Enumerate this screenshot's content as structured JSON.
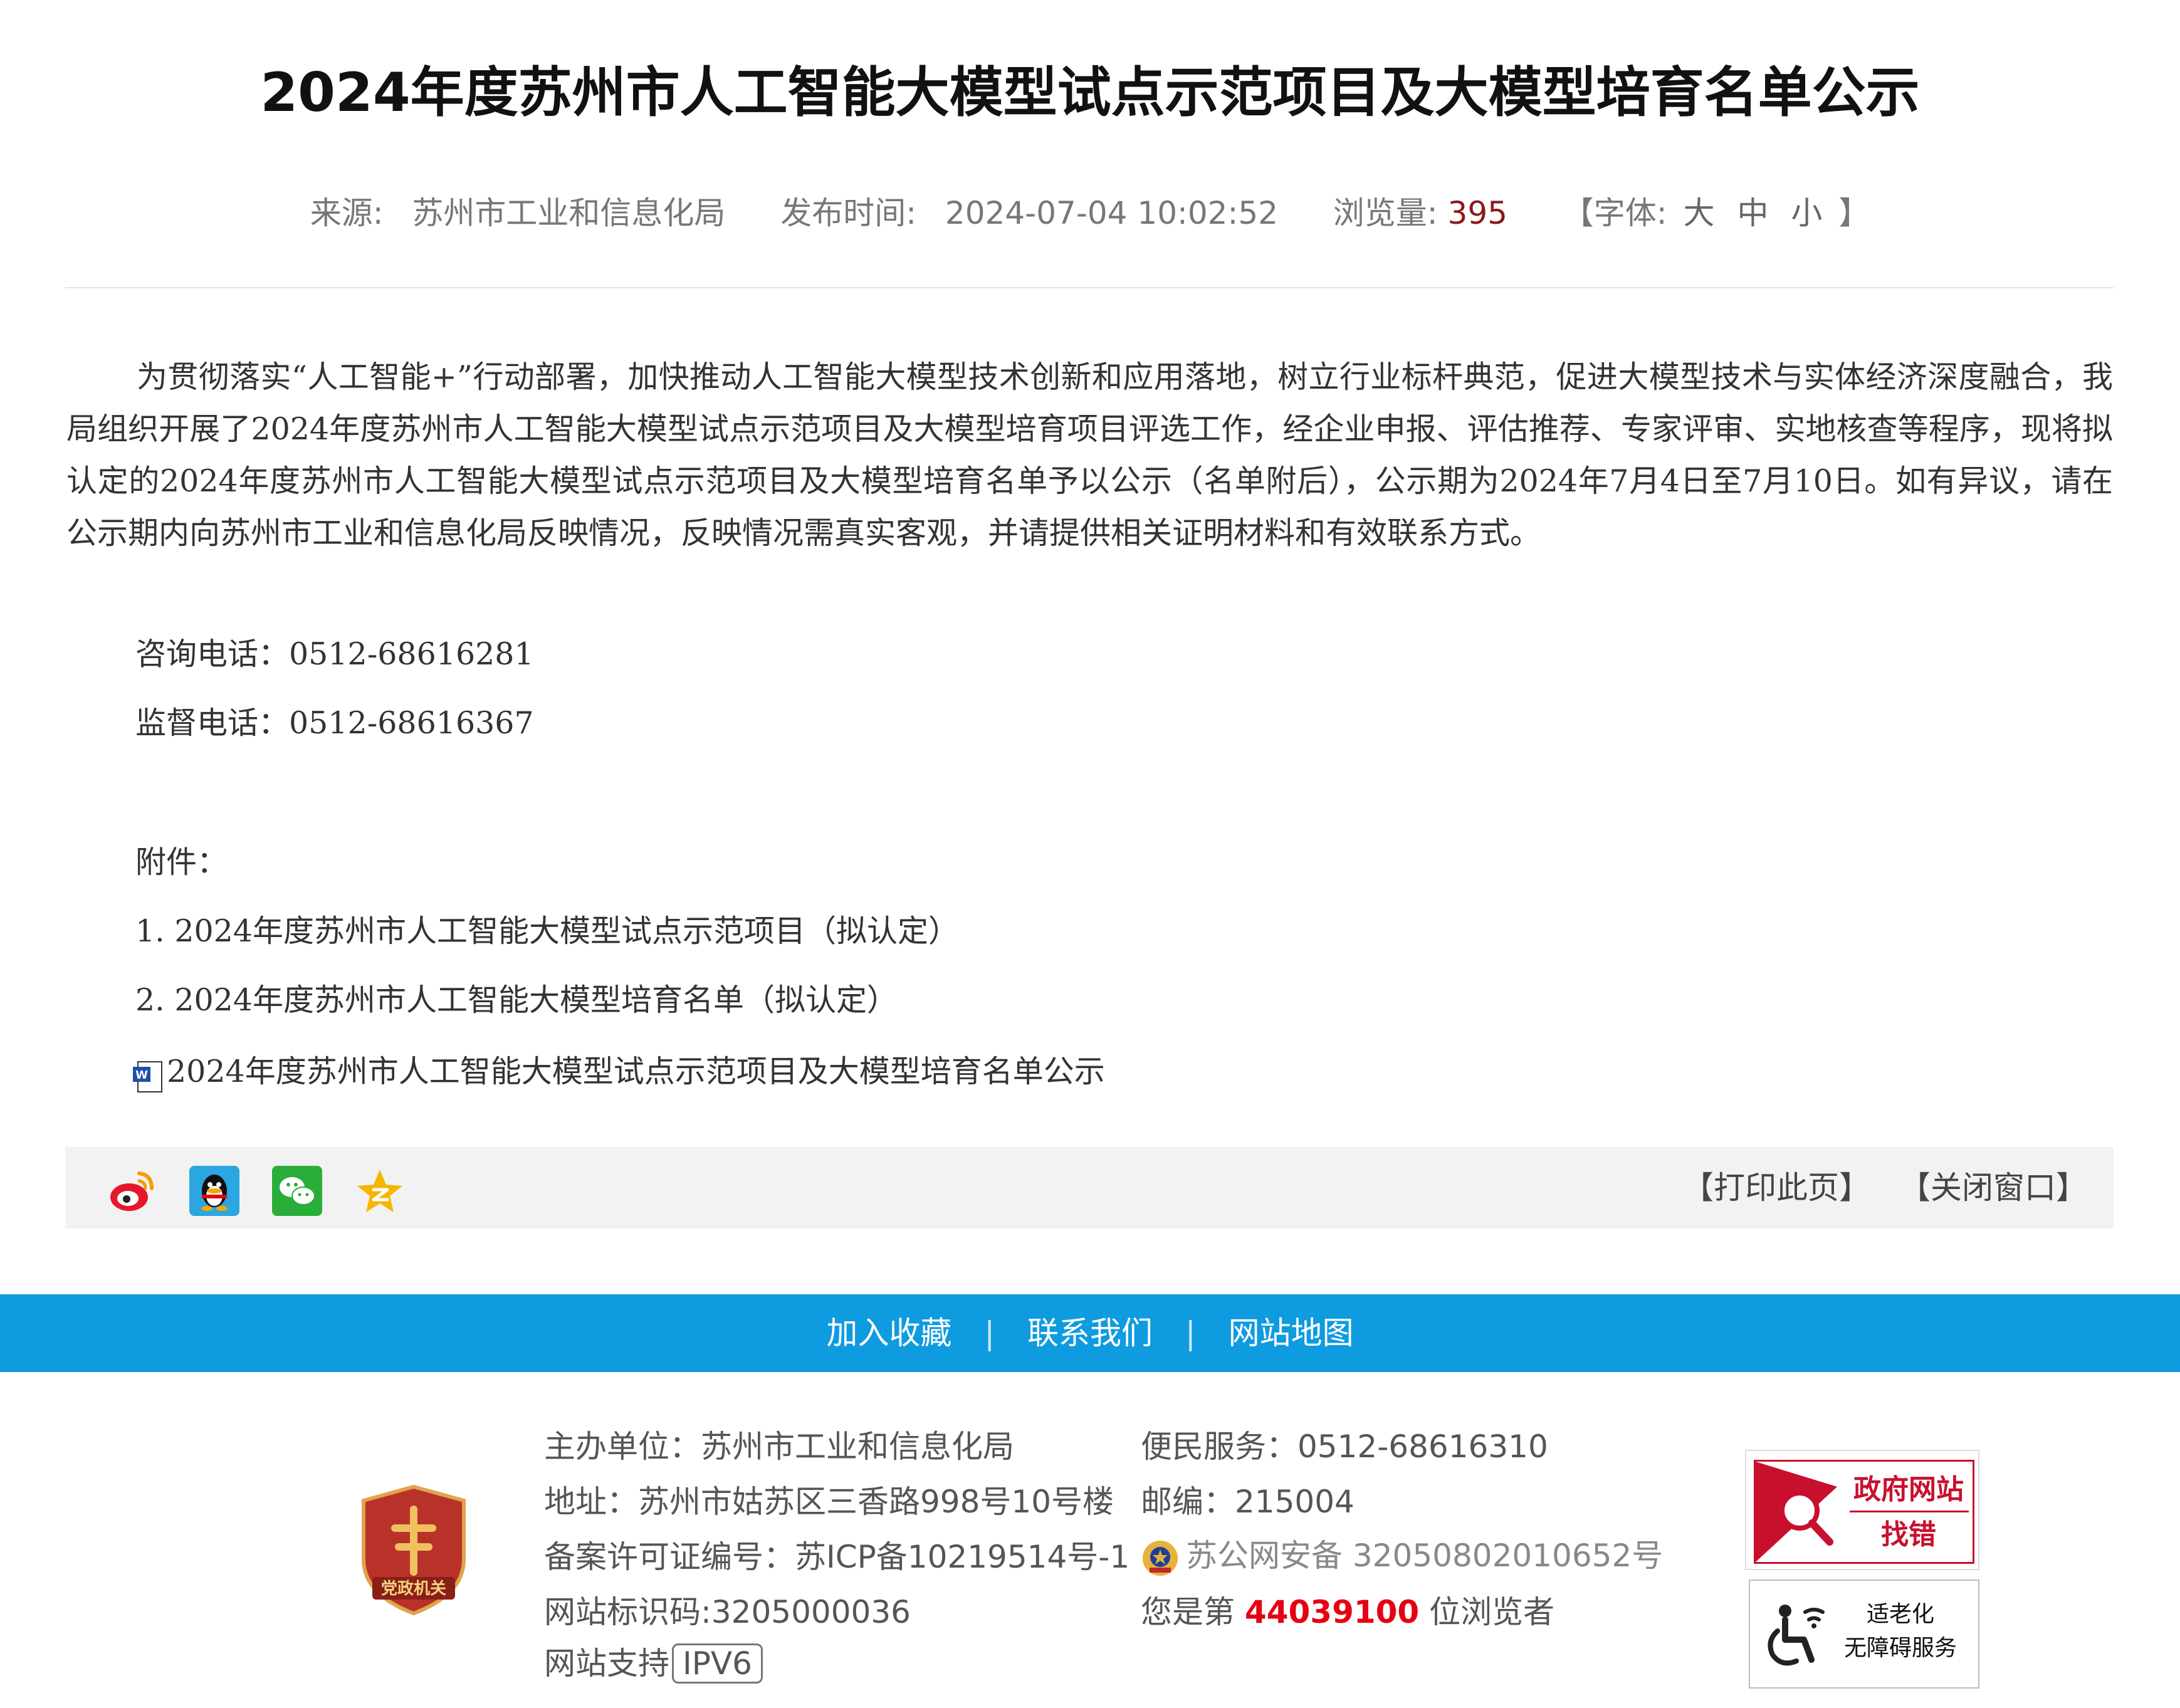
{
  "article": {
    "title": "2024年度苏州市人工智能大模型试点示范项目及大模型培育名单公示",
    "meta": {
      "source_label": "来源:",
      "source": "苏州市工业和信息化局",
      "date_label": "发布时间:",
      "date": "2024-07-04 10:02:52",
      "views_label": "浏览量:",
      "views": "395",
      "font_label_open": "【字体:",
      "font_large": "大",
      "font_medium": "中",
      "font_small": "小",
      "font_label_close": "】"
    },
    "body": "为贯彻落实“人工智能+”行动部署，加快推动人工智能大模型技术创新和应用落地，树立行业标杆典范，促进大模型技术与实体经济深度融合，我局组织开展了2024年度苏州市人工智能大模型试点示范项目及大模型培育项目评选工作，经企业申报、评估推荐、专家评审、实地核查等程序，现将拟认定的2024年度苏州市人工智能大模型试点示范项目及大模型培育名单予以公示（名单附后），公示期为2024年7月4日至7月10日。如有异议，请在公示期内向苏州市工业和信息化局反映情况，反映情况需真实客观，并请提供相关证明材料和有效联系方式。",
    "consult_phone": "咨询电话：0512-68616281",
    "supervise_phone": "监督电话：0512-68616367",
    "attachments_label": "附件：",
    "attachments": [
      "1. 2024年度苏州市人工智能大模型试点示范项目（拟认定）",
      "2. 2024年度苏州市人工智能大模型培育名单（拟认定）"
    ],
    "file_link": "2024年度苏州市人工智能大模型试点示范项目及大模型培育名单公示"
  },
  "share_bar": {
    "icons": [
      "weibo-icon",
      "qq-icon",
      "wechat-icon",
      "qzone-icon"
    ],
    "print_label": "【打印此页】",
    "close_label": "【关闭窗口】"
  },
  "footer_nav": {
    "links": [
      "加入收藏",
      "联系我们",
      "网站地图"
    ],
    "separator": "|"
  },
  "footer": {
    "host": "主办单位：苏州市工业和信息化局",
    "address": "地址：苏州市姑苏区三香路998号10号楼",
    "icp": "备案许可证编号：苏ICP备10219514号-1",
    "site_code": "网站标识码:3205000036",
    "ipv6_prefix": "网站支持",
    "ipv6": "IPV6",
    "service": "便民服务：0512-68616310",
    "postcode": "邮编：215004",
    "police_record": "苏公网安备 32050802010652号",
    "visitor_prefix": "您是第",
    "visitor_count": "44039100",
    "visitor_suffix": "位浏览者",
    "party_badge_text": "党政机关",
    "gov_error_line1": "政府网站",
    "gov_error_line2": "找错",
    "access_line1": "适老化",
    "access_line2": "无障碍服务"
  },
  "colors": {
    "blue_bar": "#0e9be0",
    "views": "#8b1a1a",
    "visitor_count": "#e60012",
    "share_bar_bg": "#f2f2f2"
  }
}
